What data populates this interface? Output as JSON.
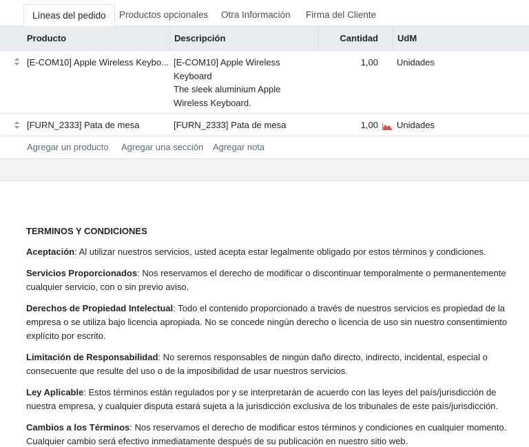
{
  "tabs": [
    {
      "label": "Líneas del pedido"
    },
    {
      "label": "Productos opcionales"
    },
    {
      "label": "Otra Información"
    },
    {
      "label": "Firma del Cliente"
    }
  ],
  "table": {
    "headers": {
      "product": "Producto",
      "description": "Descripción",
      "quantity": "Cantidad",
      "uom": "UdM"
    },
    "rows": [
      {
        "product": "[E-COM10] Apple Wireless Keybo...",
        "description_lines": [
          "[E-COM10] Apple Wireless",
          "Keyboard",
          "The sleek aluminium Apple",
          "Wireless Keyboard."
        ],
        "quantity": "1,00",
        "uom": "Unidades"
      },
      {
        "product": "[FURN_2333] Pata de mesa",
        "description_lines": [
          "[FURN_2333] Pata de mesa"
        ],
        "quantity": "1,00",
        "uom": "Unidades",
        "forecast_icon": "area-chart-icon",
        "forecast_color": "#d9534f"
      }
    ]
  },
  "add_links": {
    "product": "Agregar un producto",
    "section": "Agregar una sección",
    "note": "Agregar nota"
  },
  "terms": {
    "title": "TERMINOS Y CONDICIONES",
    "items": [
      {
        "heading": "Aceptación",
        "text": ": Al utilizar nuestros servicios, usted acepta estar legalmente obligado por estos términos y condiciones."
      },
      {
        "heading": "Servicios Proporcionados",
        "text": ": Nos reservamos el derecho de modificar o discontinuar temporalmente o permanentemente cualquier servicio, con o sin previo aviso."
      },
      {
        "heading": "Derechos de Propiedad Intelectual",
        "text": ": Todo el contenido proporcionado a través de nuestros servicios es propiedad de la empresa o se utiliza bajo licencia apropiada. No se concede ningún derecho o licencia de uso sin nuestro consentimiento explícito por escrito."
      },
      {
        "heading": "Limitación de Responsabilidad",
        "text": ": No seremos responsables de ningún daño directo, indirecto, incidental, especial o consecuente que resulte del uso o de la imposibilidad de usar nuestros servicios."
      },
      {
        "heading": "Ley Aplicable",
        "text": ": Estos términos están regulados por y se interpretarán de acuerdo con las leyes del país/jurisdicción de nuestra empresa, y cualquier disputa estará sujeta a la jurisdicción exclusiva de los tribunales de este país/jurisdicción."
      },
      {
        "heading": "Cambios a los Términos",
        "text": ": Nos reservamos el derecho de modificar estos términos y condiciones en cualquier momento. Cualquier cambio será efectivo inmediatamente después de su publicación en nuestro sitio web."
      }
    ]
  }
}
